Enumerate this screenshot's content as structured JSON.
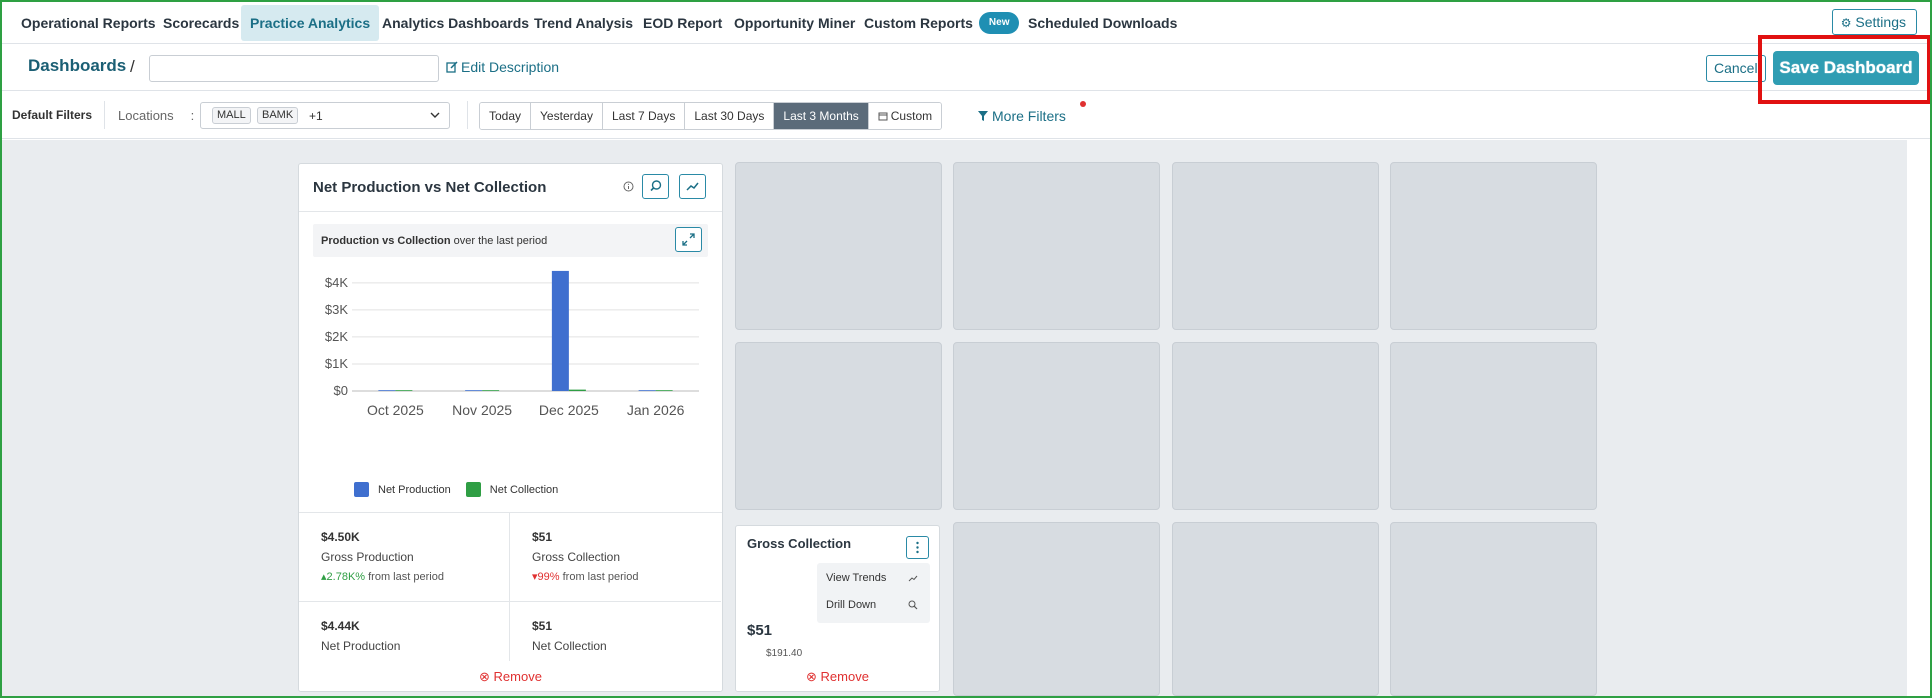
{
  "nav": {
    "items": [
      {
        "label": "Operational Reports"
      },
      {
        "label": "Scorecards"
      },
      {
        "label": "Practice Analytics"
      },
      {
        "label": "Analytics Dashboards"
      },
      {
        "label": "Trend Analysis"
      },
      {
        "label": "EOD Report"
      },
      {
        "label": "Opportunity Miner"
      },
      {
        "label": "Custom Reports",
        "badge": "New"
      },
      {
        "label": "Scheduled Downloads"
      }
    ],
    "active": "Practice Analytics",
    "settings_label": "Settings"
  },
  "titlebar": {
    "breadcrumb": "Dashboards",
    "separator": "/",
    "dashboard_name_value": "",
    "edit_description": "Edit Description",
    "cancel_label": "Cancel",
    "save_label": "Save Dashboard"
  },
  "filters": {
    "default_label": "Default Filters",
    "locations_label": "Locations",
    "locations_colon": ":",
    "location_chips": [
      "MALL",
      "BAMK"
    ],
    "locations_more": "+1",
    "date_ranges": [
      "Today",
      "Yesterday",
      "Last 7 Days",
      "Last 30 Days",
      "Last 3 Months",
      "Custom"
    ],
    "active_range": "Last 3 Months",
    "more_filters": "More Filters"
  },
  "chart_card": {
    "title": "Net Production vs Net Collection",
    "subtitle_bold": "Production vs Collection",
    "subtitle_rest": "over the last period",
    "stats": [
      {
        "value": "$4.50K",
        "label": "Gross Production",
        "change": "2.78K%",
        "direction": "up",
        "suffix": "from last period"
      },
      {
        "value": "$51",
        "label": "Gross Collection",
        "change": "99%",
        "direction": "down",
        "suffix": "from last period"
      },
      {
        "value": "$4.44K",
        "label": "Net Production"
      },
      {
        "value": "$51",
        "label": "Net Collection"
      }
    ],
    "remove_label": "Remove"
  },
  "chart_data": {
    "type": "bar",
    "categories": [
      "Oct 2025",
      "Nov 2025",
      "Dec 2025",
      "Jan 2026"
    ],
    "series": [
      {
        "name": "Net Production",
        "color": "#3f6fcf",
        "values": [
          0,
          0,
          4440,
          0
        ]
      },
      {
        "name": "Net Collection",
        "color": "#2f9e44",
        "values": [
          0,
          0,
          51,
          0
        ]
      }
    ],
    "ytick_labels": [
      "$0",
      "$1K",
      "$2K",
      "$3K",
      "$4K"
    ],
    "ytick_values": [
      0,
      1000,
      2000,
      3000,
      4000
    ],
    "ylim": [
      0,
      4400
    ],
    "grid": true,
    "legend": "bottom"
  },
  "gross_collection_card": {
    "title": "Gross Collection",
    "menu": [
      {
        "label": "View Trends",
        "icon": "trend-icon"
      },
      {
        "label": "Drill Down",
        "icon": "magnifier-icon"
      }
    ],
    "value": "$51",
    "partial_sub": "$191.40",
    "remove_label": "Remove"
  },
  "colors": {
    "brand": "#1b6f86",
    "save_button": "#2f9db3",
    "active_range": "#5b6b7a",
    "highlight": "#e11111",
    "tile": "#d7dce1",
    "canvas": "#e9ecef"
  }
}
